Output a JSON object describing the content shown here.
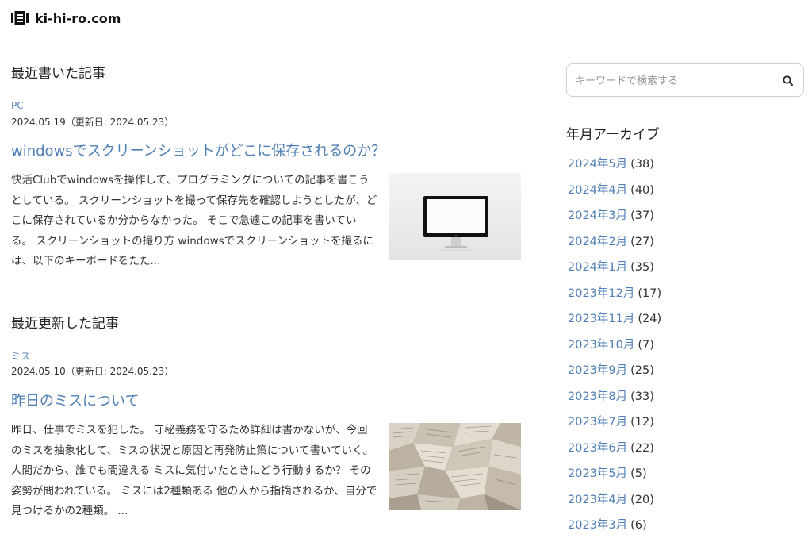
{
  "site": {
    "name": "ki-hi-ro.com"
  },
  "sections": [
    {
      "heading": "最近書いた記事",
      "post": {
        "category": "PC",
        "date": "2024.05.19（更新日: 2024.05.23）",
        "title": "windowsでスクリーンショットがどこに保存されるのか？",
        "excerpt": "快活Clubでwindowsを操作して、プログラミングについての記事を書こうとしている。 スクリーンショットを撮って保存先を確認しようとしたが、どこに保存されているか分からなかった。 そこで急遽この記事を書いている。 スクリーンショットの撮り方 windowsでスクリーンショットを撮るには、以下のキーボードをたた..."
      }
    },
    {
      "heading": "最近更新した記事",
      "post": {
        "category": "ミス",
        "date": "2024.05.10（更新日: 2024.05.23）",
        "title": "昨日のミスについて",
        "excerpt": "昨日、仕事でミスを犯した。 守秘義務を守るため詳細は書かないが、今回のミスを抽象化して、ミスの状況と原因と再発防止策について書いていく。 人間だから、誰でも間違える ミスに気付いたときにどう行動するか？ その姿勢が問われている。 ミスには2種類ある 他の人から指摘されるか、自分で見つけるかの2種類。 ..."
      }
    }
  ],
  "search": {
    "placeholder": "キーワードで検索する"
  },
  "archive": {
    "title": "年月アーカイブ",
    "items": [
      {
        "label": "2024年5月",
        "count": "(38)"
      },
      {
        "label": "2024年4月",
        "count": "(40)"
      },
      {
        "label": "2024年3月",
        "count": "(37)"
      },
      {
        "label": "2024年2月",
        "count": "(27)"
      },
      {
        "label": "2024年1月",
        "count": "(35)"
      },
      {
        "label": "2023年12月",
        "count": "(17)"
      },
      {
        "label": "2023年11月",
        "count": "(24)"
      },
      {
        "label": "2023年10月",
        "count": "(7)"
      },
      {
        "label": "2023年9月",
        "count": "(25)"
      },
      {
        "label": "2023年8月",
        "count": "(33)"
      },
      {
        "label": "2023年7月",
        "count": "(12)"
      },
      {
        "label": "2023年6月",
        "count": "(22)"
      },
      {
        "label": "2023年5月",
        "count": "(5)"
      },
      {
        "label": "2023年4月",
        "count": "(20)"
      },
      {
        "label": "2023年3月",
        "count": "(6)"
      }
    ]
  }
}
